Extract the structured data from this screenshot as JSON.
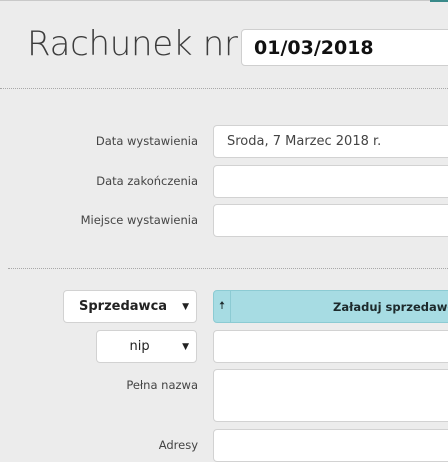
{
  "header": {
    "title": "Rachunek nr",
    "invoice_number": "01/03/2018"
  },
  "dates": {
    "issue_date_label": "Data wystawienia",
    "issue_date_value": "Środa, 7 Marzec 2018 r.",
    "end_date_label": "Data zakończenia",
    "end_date_value": "",
    "place_label": "Miejsce wystawienia",
    "place_value": ""
  },
  "seller": {
    "party_select_value": "Sprzedawca",
    "load_button_label": "Załaduj sprzedawcę",
    "load_icon": "arrow-up-icon",
    "id_type_select_value": "nip",
    "id_value": "",
    "full_name_label": "Pełna nazwa",
    "full_name_value": "",
    "address_label": "Adresy",
    "address_value": ""
  },
  "colors": {
    "background": "#ececec",
    "load_button_bg": "#a7dce3",
    "accent": "#3a8a8a"
  }
}
